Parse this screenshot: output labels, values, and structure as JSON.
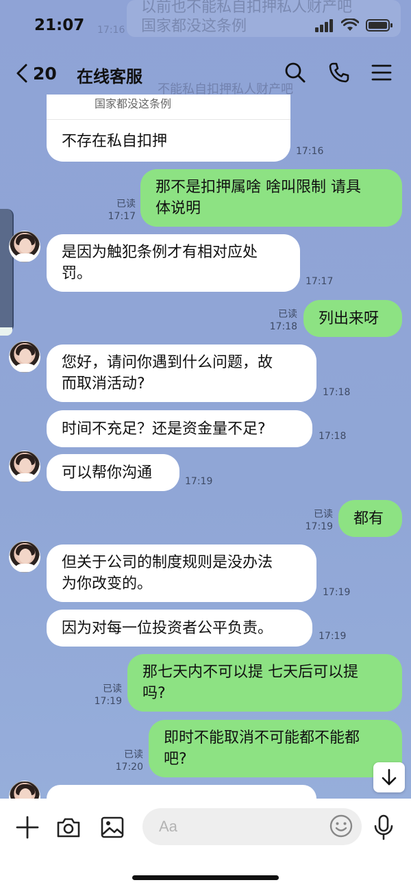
{
  "status_bar": {
    "time": "21:07"
  },
  "background_ghosts": {
    "line1": "以前也不能私自扣押私人财产吧",
    "line2": "国家都没这条例",
    "time": "17:16",
    "header_ghost": "不能私自扣押私人财产吧"
  },
  "header": {
    "back_count": "20",
    "title": "在线客服"
  },
  "quote": {
    "quoted_text": "国家都没这条例",
    "reply_text": "不存在私自扣押",
    "time": "17:16"
  },
  "messages": [
    {
      "side": "out",
      "lines": [
        "那不是扣押属啥 啥叫限制 请具",
        "体说明"
      ],
      "read": "已读",
      "time": "17:17"
    },
    {
      "side": "in",
      "avatar": true,
      "lines": [
        "是因为触犯条例才有相对应处",
        "罚。"
      ],
      "time": "17:17"
    },
    {
      "side": "out",
      "lines": [
        "列出来呀"
      ],
      "read": "已读",
      "time": "17:18"
    },
    {
      "side": "in",
      "avatar": true,
      "lines": [
        "您好，请问你遇到什么问题，故",
        "而取消活动?"
      ],
      "time": "17:18"
    },
    {
      "side": "in",
      "avatar": false,
      "lines": [
        "时间不充足？还是资金量不足?"
      ],
      "time": "17:18"
    },
    {
      "side": "in",
      "avatar": true,
      "lines": [
        "可以帮你沟通"
      ],
      "time": "17:19"
    },
    {
      "side": "out",
      "lines": [
        "都有"
      ],
      "read": "已读",
      "time": "17:19"
    },
    {
      "side": "in",
      "avatar": true,
      "lines": [
        "但关于公司的制度规则是没办法",
        "为你改变的。"
      ],
      "time": "17:19"
    },
    {
      "side": "in",
      "avatar": false,
      "lines": [
        "因为对每一位投资者公平负责。"
      ],
      "time": "17:19"
    },
    {
      "side": "out",
      "lines": [
        "那七天内不可以提 七天后可以提",
        "吗?"
      ],
      "read": "已读",
      "time": "17:19"
    },
    {
      "side": "out",
      "lines": [
        "即时不能取消不可能都不能都",
        "吧?"
      ],
      "read": "已读",
      "time": "17:20"
    }
  ],
  "composer": {
    "placeholder": "Aa"
  },
  "icons": {
    "back": "chevron-left-icon",
    "search": "search-icon",
    "phone": "phone-icon",
    "menu": "menu-icon",
    "plus": "plus-icon",
    "camera": "camera-icon",
    "image": "image-icon",
    "emoji": "emoji-icon",
    "mic": "mic-icon",
    "scroll_down": "arrow-down-icon"
  }
}
